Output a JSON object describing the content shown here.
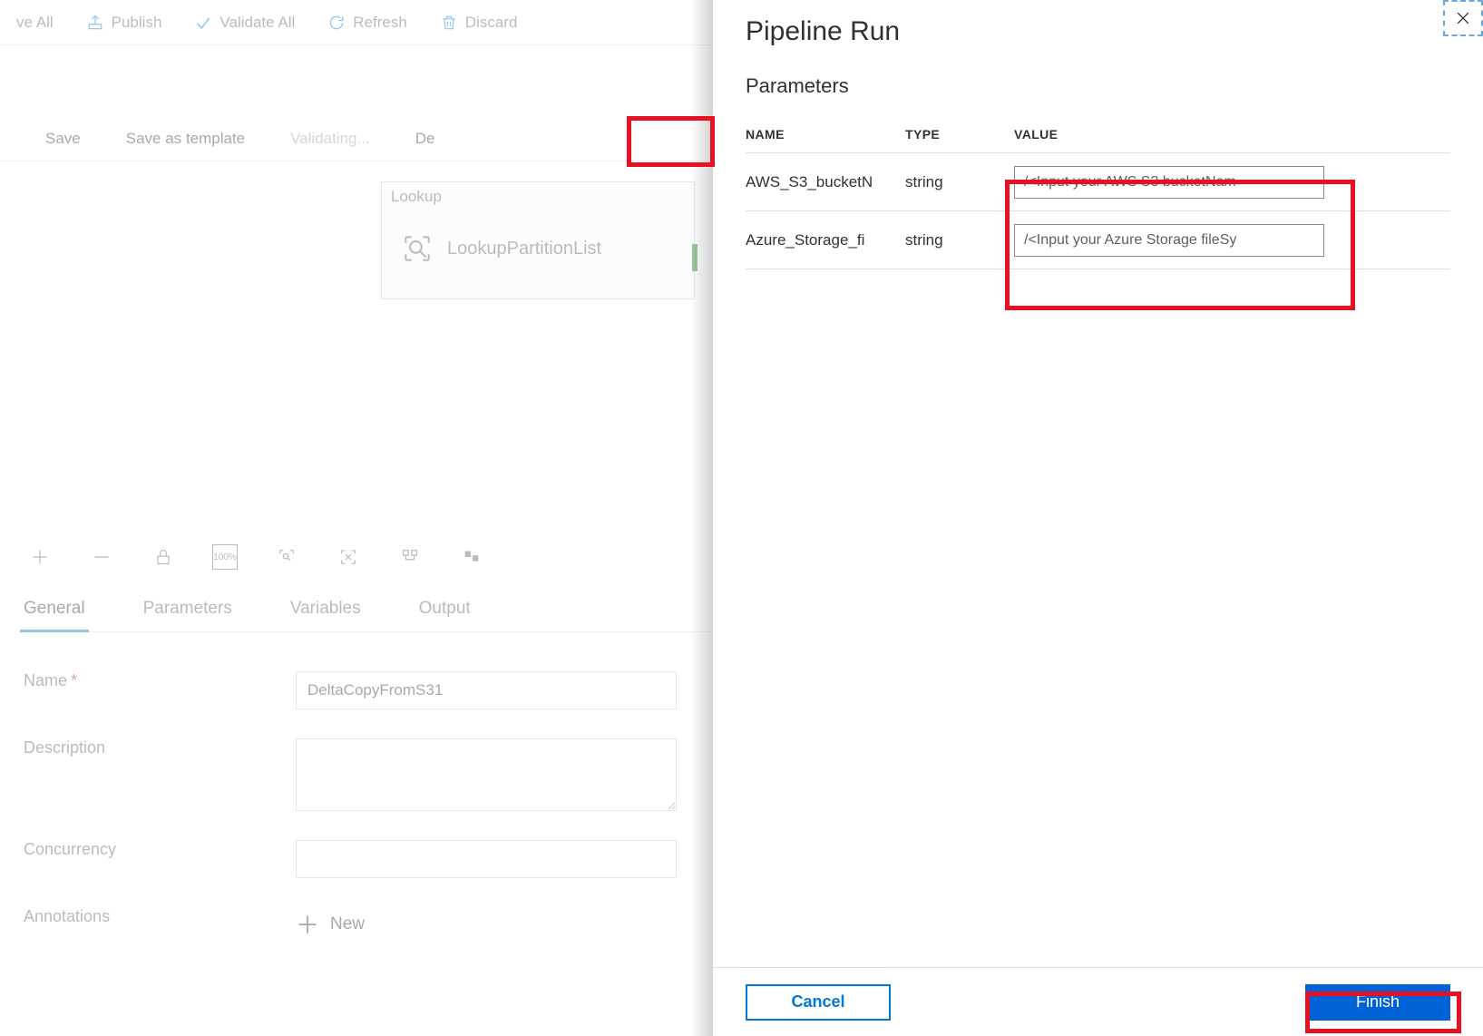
{
  "top_toolbar": {
    "save_all": "ve All",
    "publish": "Publish",
    "validate_all": "Validate All",
    "refresh": "Refresh",
    "discard": "Discard"
  },
  "inner_toolbar": {
    "save": "Save",
    "save_template": "Save as template",
    "validating": "Validating...",
    "debug": "De"
  },
  "lookup": {
    "title": "Lookup",
    "name": "LookupPartitionList"
  },
  "tabs": {
    "general": "General",
    "parameters": "Parameters",
    "variables": "Variables",
    "output": "Output"
  },
  "form": {
    "name_label": "Name",
    "name_value": "DeltaCopyFromS31",
    "description_label": "Description",
    "concurrency_label": "Concurrency",
    "annotations_label": "Annotations",
    "new_label": "New"
  },
  "panel": {
    "title": "Pipeline Run",
    "subtitle": "Parameters",
    "columns": {
      "name": "NAME",
      "type": "TYPE",
      "value": "VALUE"
    },
    "rows": [
      {
        "name": "AWS_S3_bucketN",
        "type": "string",
        "value": "/<Input your AWS S3 bucketNam"
      },
      {
        "name": "Azure_Storage_fi",
        "type": "string",
        "value": "/<Input your Azure Storage fileSy"
      }
    ],
    "cancel": "Cancel",
    "finish": "Finish"
  }
}
